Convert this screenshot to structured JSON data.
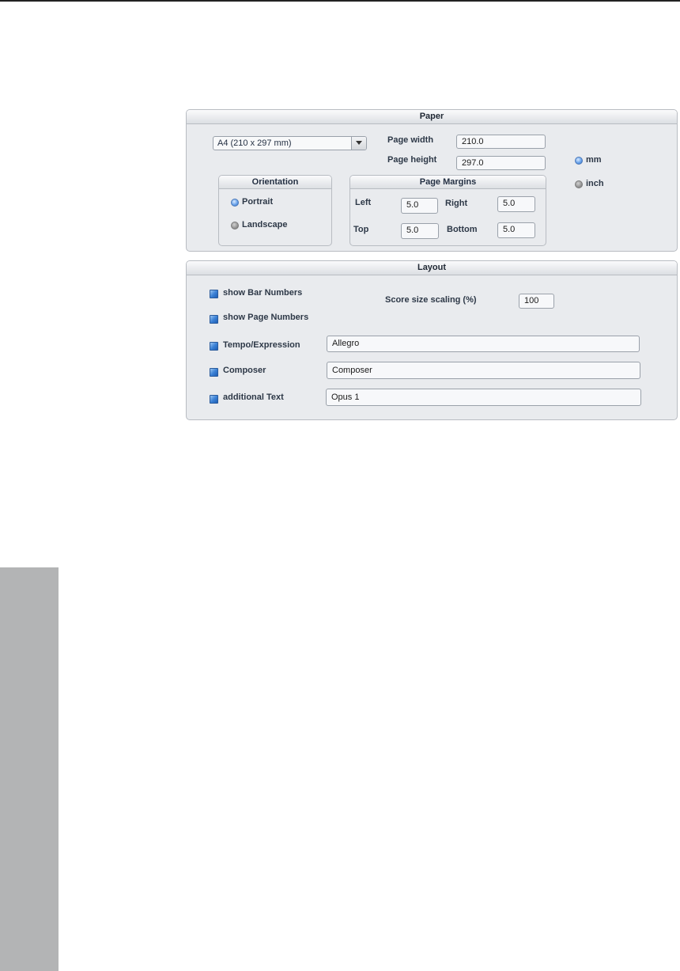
{
  "paper": {
    "title": "Paper",
    "paper_size": "A4 (210 x 297 mm)",
    "page_width_label": "Page width",
    "page_width_value": "210.0",
    "page_height_label": "Page height",
    "page_height_value": "297.0",
    "units": [
      {
        "label": "mm",
        "selected": true
      },
      {
        "label": "inch",
        "selected": false
      }
    ],
    "orientation": {
      "title": "Orientation",
      "options": [
        {
          "label": "Portrait",
          "selected": true
        },
        {
          "label": "Landscape",
          "selected": false
        }
      ]
    },
    "margins": {
      "title": "Page Margins",
      "left_label": "Left",
      "left_value": "5.0",
      "right_label": "Right",
      "right_value": "5.0",
      "top_label": "Top",
      "top_value": "5.0",
      "bottom_label": "Bottom",
      "bottom_value": "5.0"
    }
  },
  "layout": {
    "title": "Layout",
    "show_bar_numbers": {
      "label": "show Bar Numbers",
      "checked": true
    },
    "show_page_numbers": {
      "label": "show Page Numbers",
      "checked": true
    },
    "score_size_label": "Score size scaling (%)",
    "score_size_value": "100",
    "tempo": {
      "label": "Tempo/Expression",
      "checked": true,
      "value": "Allegro"
    },
    "composer": {
      "label": "Composer",
      "checked": true,
      "value": "Composer"
    },
    "additional_text": {
      "label": "additional Text",
      "checked": true,
      "value": "Opus 1"
    }
  },
  "colors": {
    "panel_bg": "#e9ebee",
    "accent_blue": "#3c82d6",
    "side_tab": "#b3b4b5"
  }
}
